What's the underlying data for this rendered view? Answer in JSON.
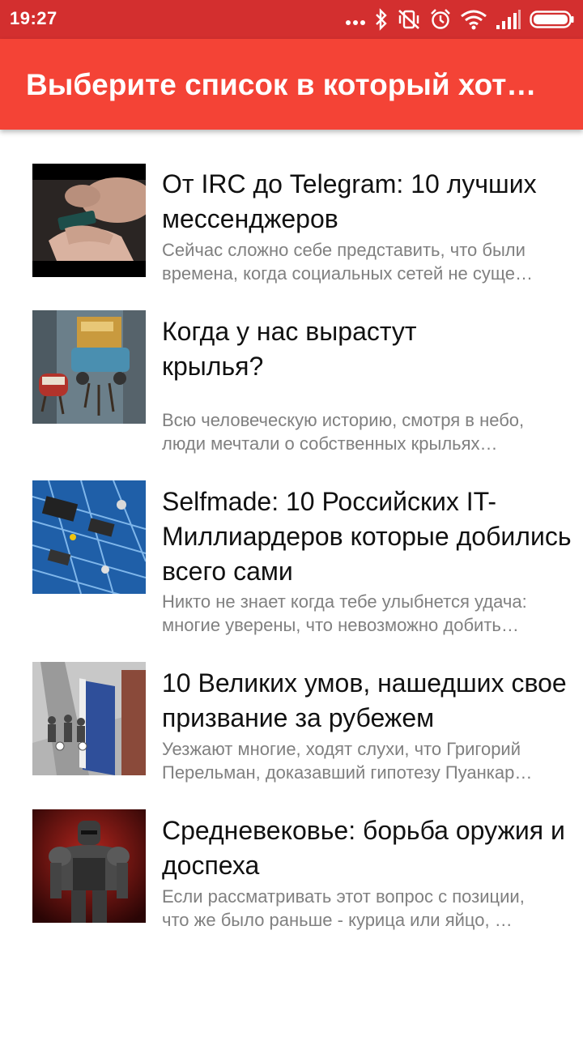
{
  "status_bar": {
    "time": "19:27",
    "icons": [
      "more-dots-icon",
      "bluetooth-icon",
      "vibrate-off-icon",
      "alarm-icon",
      "wifi-icon",
      "signal-icon",
      "battery-icon"
    ]
  },
  "app_bar": {
    "title": "Выберите список в который хот…",
    "color": "#f44336",
    "status_color": "#d32f2f"
  },
  "articles": [
    {
      "title": "От IRC до Telegram: 10 лучших мессенджеров",
      "desc_line1": "Сейчас сложно себе представить, что были",
      "desc_line2": "времена, когда социальных сетей не суще…",
      "image": "phone-hands-image"
    },
    {
      "title": "Когда у нас вырастут крылья?",
      "desc_line1": "Всю человеческую историю, смотря в небо,",
      "desc_line2": "люди мечтали о собственных крыльях…",
      "image": "flying-truck-image"
    },
    {
      "title": "Selfmade: 10 Российских IT-Миллиардеров которые добились всего сами",
      "desc_line1": "Никто не знает когда тебе улыбнется удача:",
      "desc_line2": "многие уверены, что невозможно добить…",
      "image": "circuit-board-image"
    },
    {
      "title": "10 Великих умов, нашедших свое призвание за рубежем",
      "desc_line1": "Уезжают многие, ходят слухи, что Григорий",
      "desc_line2": "Перельман, доказавший гипотезу Пуанкар…",
      "image": "people-book-image"
    },
    {
      "title": "Средневековье: борьба оружия и доспеха",
      "desc_line1": "Если рассматривать этот вопрос с позиции,",
      "desc_line2": "что же было раньше - курица или яйцо, …",
      "image": "armor-knight-image"
    }
  ]
}
